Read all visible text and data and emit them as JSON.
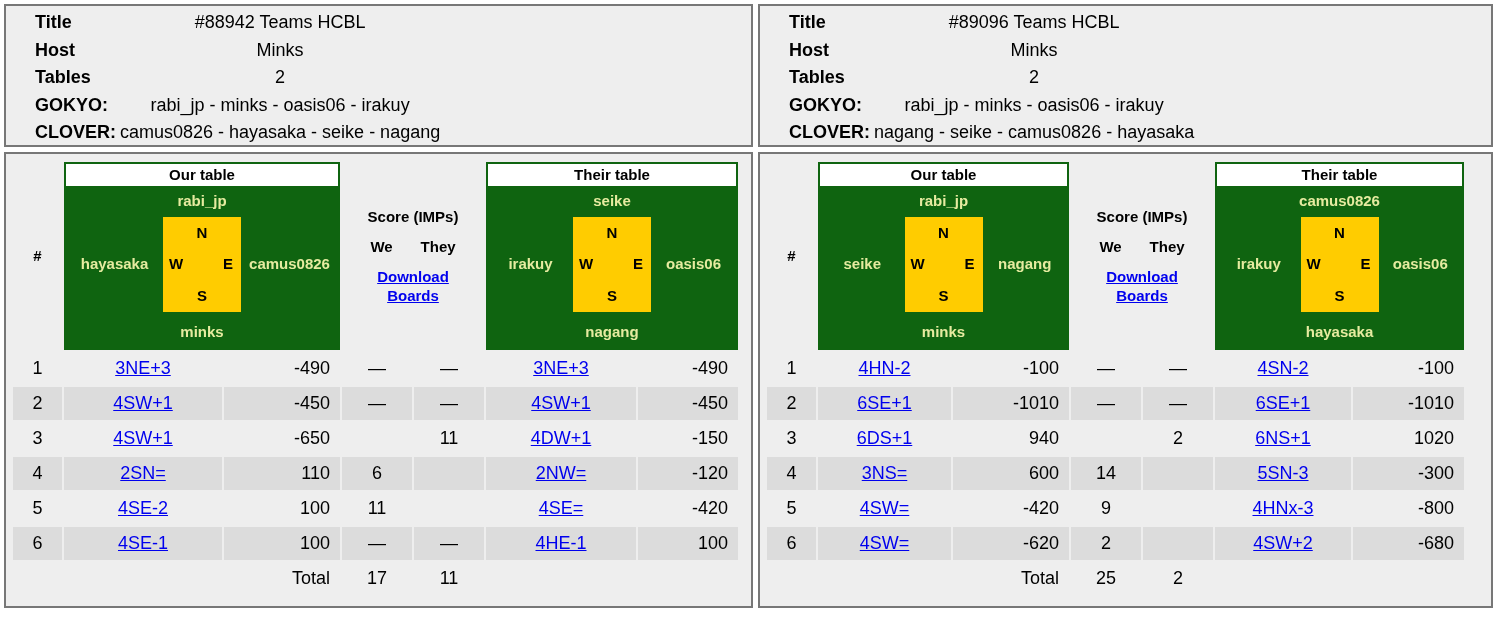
{
  "matches": [
    {
      "info": {
        "title_label": "Title",
        "title": "#88942 Teams HCBL",
        "host_label": "Host",
        "host": "Minks",
        "tables_label": "Tables",
        "tables": "2",
        "teams": [
          {
            "name": "GOKYO:",
            "players": "rabi_jp - minks - oasis06 - irakuy"
          },
          {
            "name": "CLOVER:",
            "players": "camus0826 - hayasaka - seike - nagang"
          }
        ]
      },
      "results": {
        "number_header": "#",
        "our_table": {
          "caption": "Our table",
          "north": "rabi_jp",
          "west": "hayasaka",
          "east": "camus0826",
          "south": "minks",
          "compass": [
            "N",
            "W",
            "E",
            "S"
          ]
        },
        "score_header": "Score (IMPs)",
        "we_header": "We",
        "they_header": "They",
        "download_link": "Download Boards",
        "their_table": {
          "caption": "Their table",
          "north": "seike",
          "west": "irakuy",
          "east": "oasis06",
          "south": "nagang",
          "compass": [
            "N",
            "W",
            "E",
            "S"
          ]
        },
        "boards": [
          {
            "number": "1",
            "our_contract": "3NE+3",
            "our_score": "-490",
            "we": "—",
            "they": "—",
            "their_contract": "3NE+3",
            "their_score": "-490"
          },
          {
            "number": "2",
            "our_contract": "4SW+1",
            "our_score": "-450",
            "we": "—",
            "they": "—",
            "their_contract": "4SW+1",
            "their_score": "-450"
          },
          {
            "number": "3",
            "our_contract": "4SW+1",
            "our_score": "-650",
            "they": "11",
            "their_contract": "4DW+1",
            "their_score": "-150"
          },
          {
            "number": "4",
            "our_contract": "2SN=",
            "our_score": "110",
            "we": "6",
            "their_contract": "2NW=",
            "their_score": "-120"
          },
          {
            "number": "5",
            "our_contract": "4SE-2",
            "our_score": "100",
            "we": "11",
            "their_contract": "4SE=",
            "their_score": "-420"
          },
          {
            "number": "6",
            "our_contract": "4SE-1",
            "our_score": "100",
            "we": "—",
            "they": "—",
            "their_contract": "4HE-1",
            "their_score": "100"
          }
        ],
        "total_label": "Total",
        "total_we": "17",
        "total_they": "11"
      }
    },
    {
      "info": {
        "title_label": "Title",
        "title": "#89096 Teams HCBL",
        "host_label": "Host",
        "host": "Minks",
        "tables_label": "Tables",
        "tables": "2",
        "teams": [
          {
            "name": "GOKYO:",
            "players": "rabi_jp - minks - oasis06 - irakuy"
          },
          {
            "name": "CLOVER:",
            "players": "nagang - seike - camus0826 - hayasaka"
          }
        ]
      },
      "results": {
        "number_header": "#",
        "our_table": {
          "caption": "Our table",
          "north": "rabi_jp",
          "west": "seike",
          "east": "nagang",
          "south": "minks",
          "compass": [
            "N",
            "W",
            "E",
            "S"
          ]
        },
        "score_header": "Score (IMPs)",
        "we_header": "We",
        "they_header": "They",
        "download_link": "Download Boards",
        "their_table": {
          "caption": "Their table",
          "north": "camus0826",
          "west": "irakuy",
          "east": "oasis06",
          "south": "hayasaka",
          "compass": [
            "N",
            "W",
            "E",
            "S"
          ]
        },
        "boards": [
          {
            "number": "1",
            "our_contract": "4HN-2",
            "our_score": "-100",
            "we": "—",
            "they": "—",
            "their_contract": "4SN-2",
            "their_score": "-100"
          },
          {
            "number": "2",
            "our_contract": "6SE+1",
            "our_score": "-1010",
            "we": "—",
            "they": "—",
            "their_contract": "6SE+1",
            "their_score": "-1010"
          },
          {
            "number": "3",
            "our_contract": "6DS+1",
            "our_score": "940",
            "they": "2",
            "their_contract": "6NS+1",
            "their_score": "1020"
          },
          {
            "number": "4",
            "our_contract": "3NS=",
            "our_score": "600",
            "we": "14",
            "their_contract": "5SN-3",
            "their_score": "-300"
          },
          {
            "number": "5",
            "our_contract": "4SW=",
            "our_score": "-420",
            "we": "9",
            "their_contract": "4HNx-3",
            "their_score": "-800"
          },
          {
            "number": "6",
            "our_contract": "4SW=",
            "our_score": "-620",
            "we": "2",
            "their_contract": "4SW+2",
            "their_score": "-680"
          }
        ],
        "total_label": "Total",
        "total_we": "25",
        "total_they": "2"
      }
    }
  ]
}
